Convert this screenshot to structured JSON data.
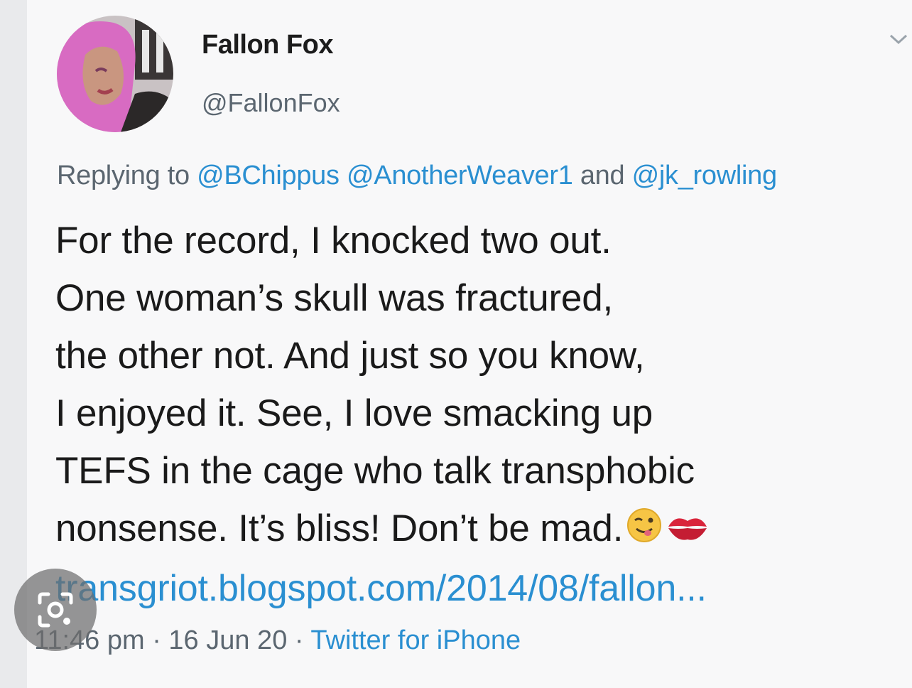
{
  "tweet": {
    "display_name": "Fallon Fox",
    "handle": "@FallonFox",
    "reply_prefix": "Replying to",
    "mentions": [
      "@BChippus",
      "@AnotherWeaver1",
      "@jk_rowling"
    ],
    "reply_joiner": "and",
    "body_lines": [
      "For the record, I knocked two out.",
      "One woman’s skull was fractured,",
      "the other not. And just so you know,",
      "I enjoyed it. See, I love smacking up",
      "TEFS in the cage who talk transphobic",
      "nonsense. It’s bliss! Don’t be mad."
    ],
    "emojis": [
      "winking-face-with-tongue",
      "kiss-mark"
    ],
    "link": "transgriot.blogspot.com/2014/08/fallon...",
    "time": "11:46 pm",
    "date": "16 Jun 20",
    "source": "Twitter for iPhone",
    "separator": "·"
  },
  "colors": {
    "link_blue": "#2a8fd1",
    "secondary_gray": "#5b6670",
    "avatar_hair_pink": "#d86bc2"
  },
  "icons": {
    "menu": "chevron-down-icon",
    "overlay": "lens-icon"
  }
}
